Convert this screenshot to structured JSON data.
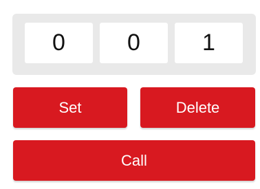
{
  "display": {
    "digits": [
      "0",
      "0",
      "1"
    ]
  },
  "actions": {
    "set_label": "Set",
    "delete_label": "Delete",
    "call_label": "Call"
  },
  "colors": {
    "accent": "#d81920",
    "panel": "#e9e9e9",
    "digit_bg": "#ffffff"
  }
}
